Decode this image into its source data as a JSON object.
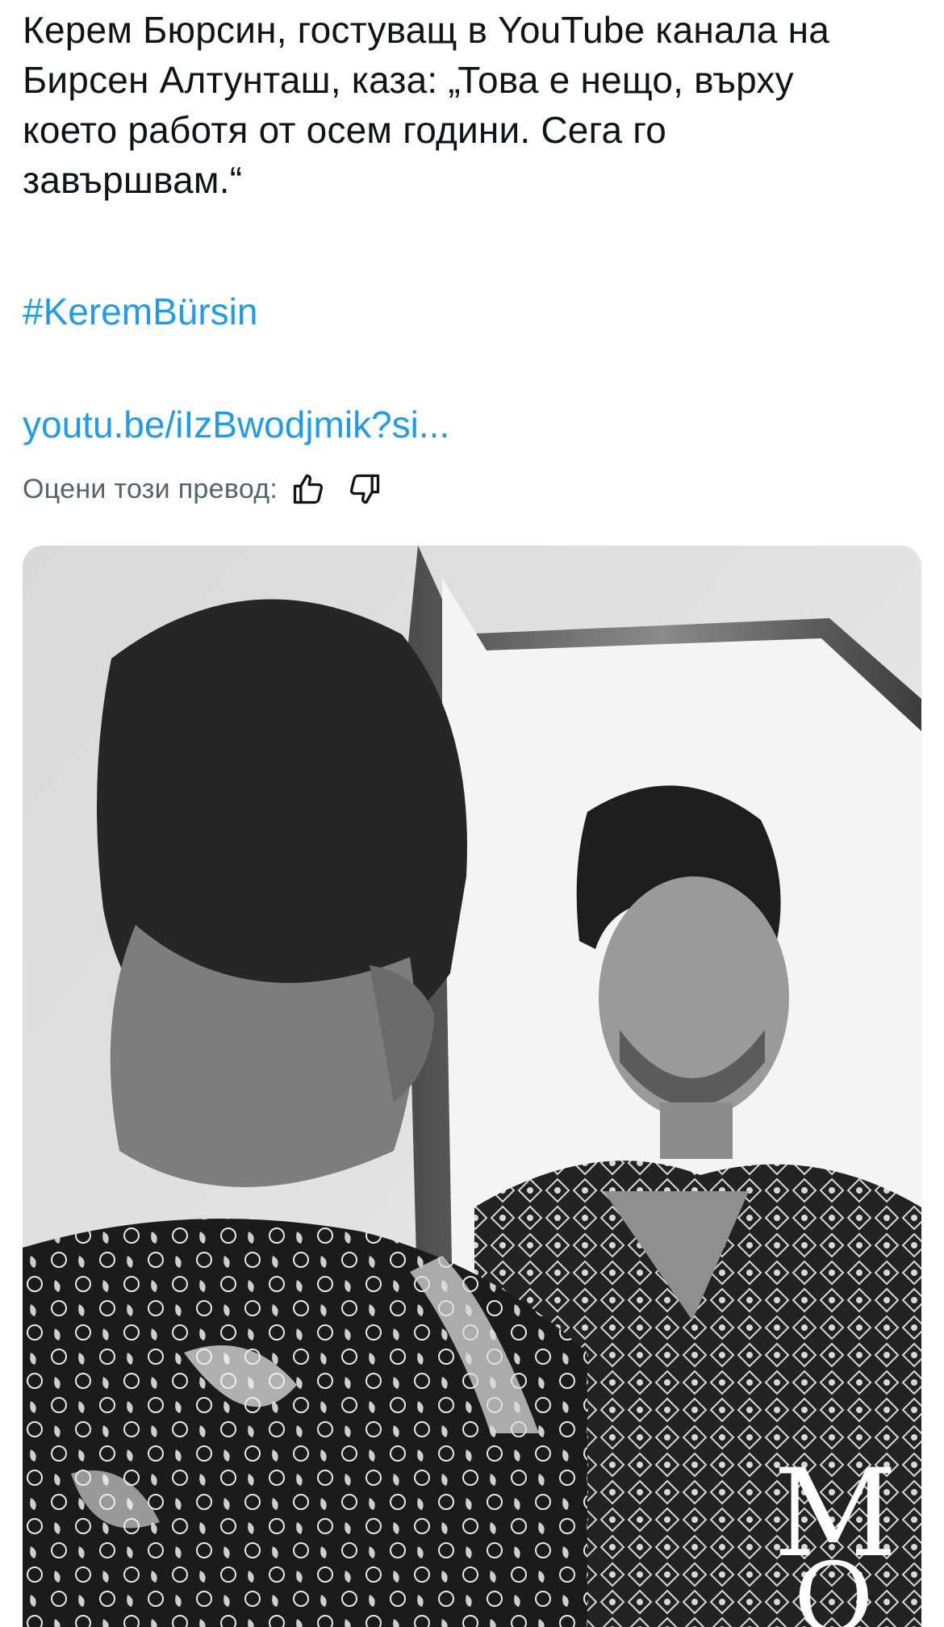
{
  "tweet": {
    "text": "Керем Бюрсин, гостуващ в YouTube канала на\nБирсен Алтунташ, каза: „Това е нещо, върху\nкоето работя от осем години. Сега го\nзавършвам.“",
    "hashtag": "#KeremBürsin",
    "link": "youtu.be/iIzBwodjmik?si..."
  },
  "translation_feedback": {
    "label": "Оцени този превод:",
    "thumbs_up_icon": "thumbs-up-icon",
    "thumbs_down_icon": "thumbs-down-icon"
  },
  "media": {
    "type": "black-and-white photo",
    "watermark_top": "M",
    "watermark_bottom": "O"
  },
  "colors": {
    "text": "#0f1419",
    "link": "#1d9bf0",
    "secondary": "#536471"
  }
}
